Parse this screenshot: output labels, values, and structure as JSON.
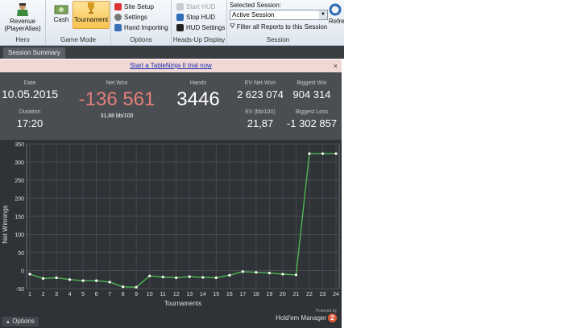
{
  "ribbon": {
    "hero": {
      "label": "Revenue (PlayerAlias)",
      "group": "Hero"
    },
    "game_mode": {
      "cash": "Cash",
      "tournament": "Tournament",
      "group": "Game Mode"
    },
    "options": {
      "items": [
        "Site Setup",
        "Settings",
        "Hand Importing"
      ],
      "group": "Options"
    },
    "hud": {
      "items": [
        "Start HUD",
        "Stop HUD",
        "HUD Settings"
      ],
      "group": "Heads-Up Display"
    },
    "session": {
      "title": "Selected Session:",
      "value": "Active Session",
      "filter": "Filter all Reports to this Session",
      "group": "Session"
    },
    "refresh": "Refres"
  },
  "tab": "Session Summary",
  "banner": "Start a TableNinja II trial now",
  "banner_close": "×",
  "stats": {
    "date_label": "Date",
    "date": "10.05.2015",
    "duration_label": "Duration",
    "duration": "17:20",
    "net_won_label": "Net Won",
    "net_won": "-136 561",
    "bb100": "31,88 bb/100",
    "hands_label": "Hands",
    "hands": "3446",
    "ev_net_won_label": "EV Net Won",
    "ev_net_won": "2 623 074",
    "ev_bb_label": "EV (bb/100)",
    "ev_bb": "21,87",
    "biggest_win_label": "Biggest Win",
    "biggest_win": "904 314",
    "biggest_loss_label": "Biggest Loss",
    "biggest_loss": "-1 302 857"
  },
  "chart_data": {
    "type": "line",
    "xlabel": "Tournaments",
    "ylabel": "Net Winnings",
    "x": [
      1,
      2,
      3,
      4,
      5,
      6,
      7,
      8,
      9,
      10,
      11,
      12,
      13,
      14,
      15,
      16,
      17,
      18,
      19,
      20,
      21,
      22,
      23,
      24
    ],
    "series": [
      {
        "values": [
          -10,
          -22,
          -20,
          -25,
          -28,
          -28,
          -32,
          -45,
          -46,
          -15,
          -18,
          -20,
          -17,
          -19,
          -20,
          -13,
          -3,
          -5,
          -7,
          -10,
          -12,
          323,
          323,
          323
        ]
      }
    ],
    "ylim": [
      -50,
      350
    ],
    "yticks": [
      -50,
      0,
      50,
      100,
      150,
      200,
      250,
      300,
      350
    ],
    "grid": true,
    "color": "#4caf50"
  },
  "bottom": {
    "options": "Options",
    "powered": "Powered by",
    "brand": "Hold'em Manager",
    "badge": "2"
  }
}
